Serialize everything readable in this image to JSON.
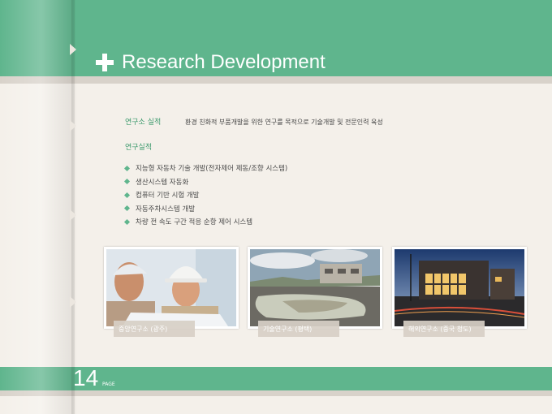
{
  "header": {
    "title": "Research Development"
  },
  "intro": {
    "label": "연구소 실적",
    "text": "환경 친화적 부품개발을 위한 연구를 목적으로 기술개발 및 전문인력 육성"
  },
  "achievements": {
    "heading": "연구실적",
    "items": [
      "지능형 자동차 기술 개발(전자제어 제동/조향 시스템)",
      "생산시스템 자동화",
      "컴퓨터 기반 시험 개발",
      "자동주차시스템 개발",
      "차량 전 속도 구간 적응 순항 제어 시스템"
    ]
  },
  "photos": [
    {
      "caption": "중앙연구소 (광주)"
    },
    {
      "caption": "기술연구소 (평택)"
    },
    {
      "caption": "해외연구소 (중국 청도)"
    }
  ],
  "footer": {
    "page_number": "14",
    "page_label": "PAGE"
  },
  "colors": {
    "accent": "#5fb58d",
    "background": "#f4f0ea",
    "stripe": "#d8d2ca"
  }
}
